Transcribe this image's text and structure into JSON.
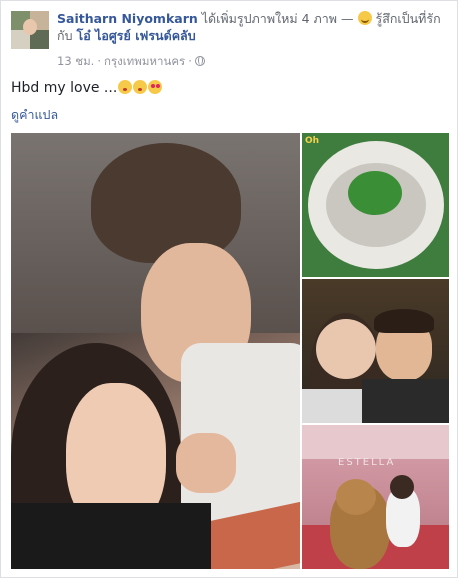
{
  "post": {
    "author": "Saitharn Niyomkarn",
    "action": "ได้เพิ่มรูปภาพใหม่ 4 ภาพ —",
    "feeling": "รู้สึกเป็นที่รักกับ",
    "tagged_friend": "โอ๋ ไอศูรย์ เฟรนด์คลับ",
    "time": "13 ชม.",
    "location": "กรุงเทพมหานคร",
    "text": "Hbd my love ...",
    "translate_link": "ดูคำแปล"
  },
  "photos": {
    "food_label": "Oh",
    "sign_text": "ESTELLA"
  },
  "icons": {
    "feeling": "blushing-face-icon",
    "privacy": "globe-icon",
    "emoji_1": "kissing-face-icon",
    "emoji_2": "kissing-face-icon",
    "emoji_3": "heart-eyes-face-icon"
  }
}
